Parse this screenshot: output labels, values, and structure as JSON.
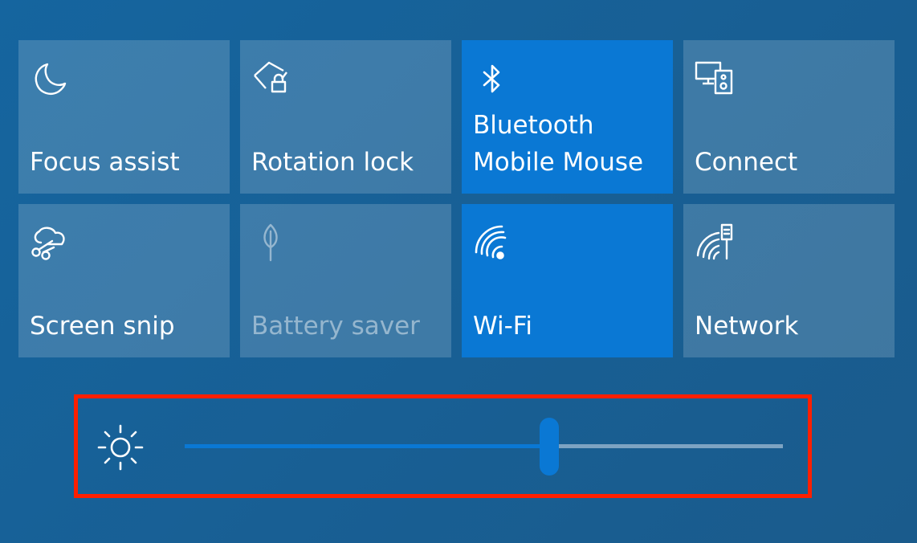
{
  "tiles": [
    {
      "label_lines": [
        "Focus assist"
      ],
      "icon": "moon-icon",
      "state": "off"
    },
    {
      "label_lines": [
        "Rotation lock"
      ],
      "icon": "rotation-lock-icon",
      "state": "off"
    },
    {
      "label_lines": [
        "Bluetooth",
        "Mobile Mouse"
      ],
      "icon": "bluetooth-icon",
      "state": "on"
    },
    {
      "label_lines": [
        "Connect"
      ],
      "icon": "connect-icon",
      "state": "off"
    },
    {
      "label_lines": [
        "Screen snip"
      ],
      "icon": "scissors-icon",
      "state": "off"
    },
    {
      "label_lines": [
        "Battery saver"
      ],
      "icon": "leaf-icon",
      "state": "disabled"
    },
    {
      "label_lines": [
        "Wi-Fi"
      ],
      "icon": "wifi-icon",
      "state": "on"
    },
    {
      "label_lines": [
        "Network"
      ],
      "icon": "network-icon",
      "state": "off"
    }
  ],
  "brightness": {
    "icon": "sun-icon",
    "level": 0.61
  },
  "colors": {
    "accent": "#0a78d4",
    "tile_off": "rgba(255,255,255,0.17)",
    "highlight_border": "#ff1f00"
  }
}
